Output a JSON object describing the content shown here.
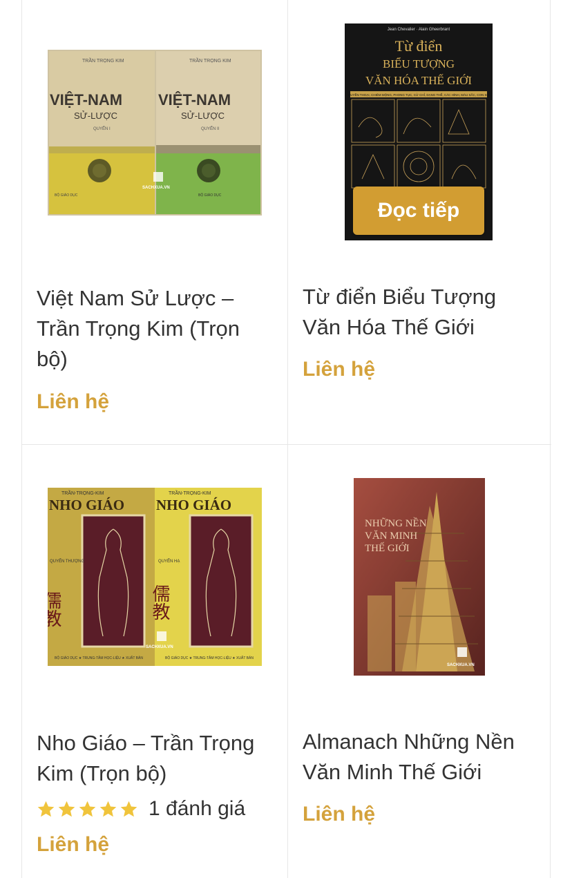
{
  "products": [
    {
      "title": "Việt Nam Sử Lược – Trần Trọng Kim (Trọn bộ)",
      "price": "Liên hệ",
      "cover": {
        "author": "TRẦN TRỌNG KIM",
        "book_title": "VIỆT-NAM",
        "subtitle": "SỬ-LƯỢC",
        "vol1": "QUYỂN I",
        "vol2": "QUYỂN II",
        "publisher": "BỘ GIÁO DỤC",
        "watermark": "SACHXUA.VN"
      }
    },
    {
      "title": "Từ điển Biểu Tượng Văn Hóa Thế Giới",
      "price": "Liên hệ",
      "read_more": "Đọc tiếp",
      "cover": {
        "authors": "Jean Chevalier · Alain Gheerbrant",
        "line1": "Từ điển",
        "line2": "BIỂU TƯỢNG",
        "line3": "VĂN HÓA THẾ GIỚI",
        "tagline": "HUYỀN THOẠI, CHIÊM MỘNG, PHONG TỤC, CỬ CHỈ, DẠNG THỂ, CÁC HÌNH, MÀU SẮC, CON SỐ"
      }
    },
    {
      "title": "Nho Giáo – Trần Trọng Kim (Trọn bộ)",
      "price": "Liên hệ",
      "rating_text": "1 đánh giá",
      "rating_value": 5,
      "cover": {
        "author": "TRẦN-TRỌNG-KIM",
        "book_title": "NHO GIÁO",
        "vol1": "QUYỂN THƯỢNG",
        "vol2": "QUYỂN HẠ",
        "hanzi": "儒教",
        "publisher": "BỘ GIÁO DỤC ★ TRUNG-TÂM HỌC-LIỆU ★ XUẤT BẢN",
        "watermark": "SACHXUA.VN"
      }
    },
    {
      "title": "Almanach Những Nền Văn Minh Thế Giới",
      "price": "Liên hệ",
      "cover": {
        "line1": "NHỮNG NỀN",
        "line2": "VĂN MINH",
        "line3": "THẾ GIỚI",
        "watermark": "SACHXUA.VN"
      }
    }
  ],
  "colors": {
    "price": "#d4a23c",
    "read_more_bg": "#d29d32",
    "star": "#f0c43c",
    "border": "#e6e6e6"
  }
}
